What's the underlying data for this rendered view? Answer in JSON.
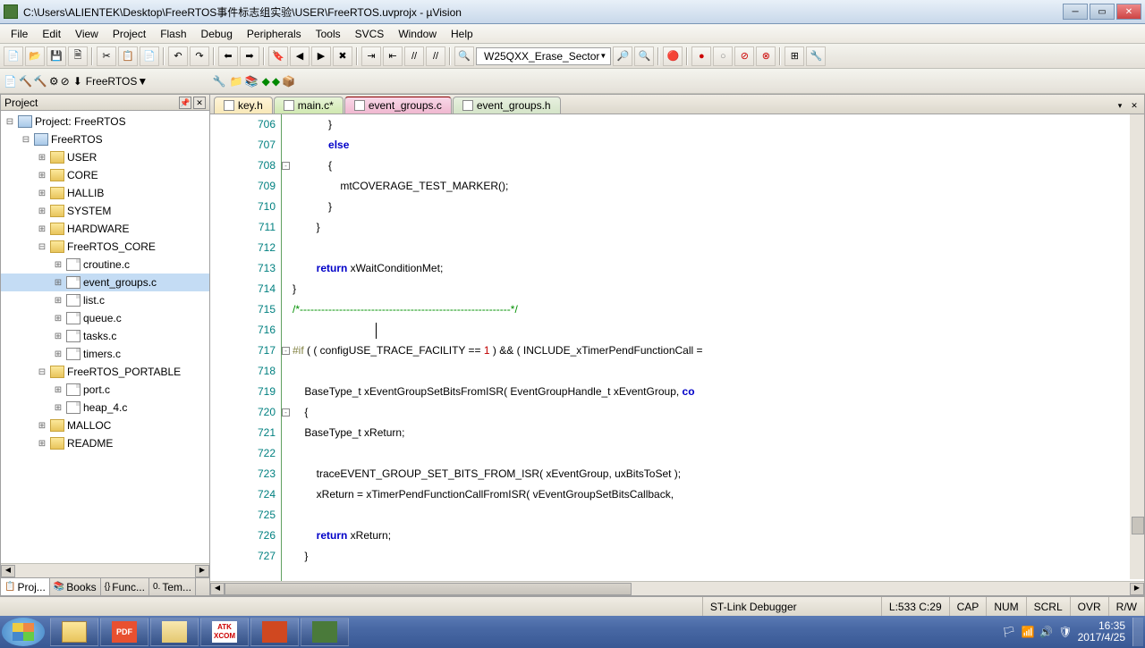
{
  "title": "C:\\Users\\ALIENTEK\\Desktop\\FreeRTOS事件标志组实验\\USER\\FreeRTOS.uvprojx - µVision",
  "menu": [
    "File",
    "Edit",
    "View",
    "Project",
    "Flash",
    "Debug",
    "Peripherals",
    "Tools",
    "SVCS",
    "Window",
    "Help"
  ],
  "toolbar_combo": "W25QXX_Erase_Sector",
  "target_combo": "FreeRTOS",
  "project_panel": {
    "title": "Project",
    "tabs": [
      "Proj...",
      "Books",
      "Func...",
      "Tem..."
    ],
    "root": "Project: FreeRTOS",
    "target": "FreeRTOS",
    "groups": [
      {
        "name": "USER",
        "files": []
      },
      {
        "name": "CORE",
        "files": []
      },
      {
        "name": "HALLIB",
        "files": []
      },
      {
        "name": "SYSTEM",
        "files": []
      },
      {
        "name": "HARDWARE",
        "files": []
      },
      {
        "name": "FreeRTOS_CORE",
        "files": [
          "croutine.c",
          "event_groups.c",
          "list.c",
          "queue.c",
          "tasks.c",
          "timers.c"
        ],
        "expanded": true,
        "selected_file": "event_groups.c"
      },
      {
        "name": "FreeRTOS_PORTABLE",
        "files": [
          "port.c",
          "heap_4.c"
        ],
        "expanded": true
      },
      {
        "name": "MALLOC",
        "files": []
      },
      {
        "name": "README",
        "files": []
      }
    ]
  },
  "editor": {
    "tabs": [
      {
        "label": "key.h",
        "cls": "t0"
      },
      {
        "label": "main.c*",
        "cls": "t1"
      },
      {
        "label": "event_groups.c",
        "cls": "t2",
        "active": true
      },
      {
        "label": "event_groups.h",
        "cls": "t3"
      }
    ],
    "first_line": 706,
    "lines": [
      {
        "n": 706,
        "html": "            }"
      },
      {
        "n": 707,
        "html": "            <span class='kw'>else</span>"
      },
      {
        "n": 708,
        "html": "            {",
        "fold": "-"
      },
      {
        "n": 709,
        "html": "                mtCOVERAGE_TEST_MARKER();"
      },
      {
        "n": 710,
        "html": "            }"
      },
      {
        "n": 711,
        "html": "        }"
      },
      {
        "n": 712,
        "html": ""
      },
      {
        "n": 713,
        "html": "        <span class='kw'>return</span> xWaitConditionMet;"
      },
      {
        "n": 714,
        "html": "}",
        "fold": ""
      },
      {
        "n": 715,
        "html": "<span class='cm'>/*-----------------------------------------------------------*/</span>"
      },
      {
        "n": 716,
        "html": "                            <span class='caret'></span>"
      },
      {
        "n": 717,
        "html": "<span class='pp'>#if</span> ( ( configUSE_TRACE_FACILITY == <span class='num'>1</span> ) && ( INCLUDE_xTimerPendFunctionCall =",
        "fold": "-"
      },
      {
        "n": 718,
        "html": ""
      },
      {
        "n": 719,
        "html": "    BaseType_t xEventGroupSetBitsFromISR( EventGroupHandle_t xEventGroup, <span class='kw'>co</span>"
      },
      {
        "n": 720,
        "html": "    {",
        "fold": "-"
      },
      {
        "n": 721,
        "html": "    BaseType_t xReturn;"
      },
      {
        "n": 722,
        "html": ""
      },
      {
        "n": 723,
        "html": "        traceEVENT_GROUP_SET_BITS_FROM_ISR( xEventGroup, uxBitsToSet );"
      },
      {
        "n": 724,
        "html": "        xReturn = xTimerPendFunctionCallFromISR( vEventGroupSetBitsCallback,"
      },
      {
        "n": 725,
        "html": ""
      },
      {
        "n": 726,
        "html": "        <span class='kw'>return</span> xReturn;"
      },
      {
        "n": 727,
        "html": "    }"
      }
    ]
  },
  "status": {
    "debugger": "ST-Link Debugger",
    "pos": "L:533 C:29",
    "caps": "CAP",
    "num": "NUM",
    "scrl": "SCRL",
    "ovr": "OVR",
    "rw": "R/W"
  },
  "taskbar": {
    "atk": "ATK\nXCOM",
    "time": "16:35",
    "date": "2017/4/25"
  }
}
